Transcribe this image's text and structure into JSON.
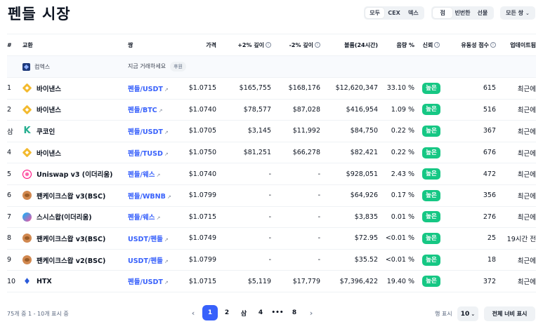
{
  "header": {
    "title": "펜들 시장",
    "filter_a": [
      "모두",
      "CEX",
      "덱스"
    ],
    "filter_b": [
      "점",
      "빈번한",
      "선물"
    ],
    "pairs_dropdown": "모든 쌍"
  },
  "table": {
    "columns": [
      "#",
      "교환",
      "쌍",
      "가격",
      "+2% 깊이",
      "-2% 깊이",
      "볼륨(24시간)",
      "음량 %",
      "신뢰",
      "유동성 점수",
      "업데이트됨"
    ],
    "sponsor": {
      "name": "컴엑스",
      "text": "지금 거래하세요",
      "badge": "후원"
    },
    "rows": [
      {
        "rank": "1",
        "exchange": "바이낸스",
        "logo": "binance-logo-icon",
        "pair": "펜들/USDT",
        "price": "$1.0715",
        "plus2": "$165,755",
        "minus2": "$168,176",
        "volume": "$12,620,347",
        "vol_pct": "33.10 %",
        "trust": "높은",
        "liq": "615",
        "updated": "최근에"
      },
      {
        "rank": "2",
        "exchange": "바이낸스",
        "logo": "binance-logo-icon",
        "pair": "펜들/BTC",
        "price": "$1.0740",
        "plus2": "$78,577",
        "minus2": "$87,028",
        "volume": "$416,954",
        "vol_pct": "1.09 %",
        "trust": "높은",
        "liq": "516",
        "updated": "최근에"
      },
      {
        "rank": "삼",
        "exchange": "쿠코인",
        "logo": "kucoin-logo-icon",
        "pair": "펜들/USDT",
        "price": "$1.0705",
        "plus2": "$3,145",
        "minus2": "$11,992",
        "volume": "$84,750",
        "vol_pct": "0.22 %",
        "trust": "높은",
        "liq": "367",
        "updated": "최근에"
      },
      {
        "rank": "4",
        "exchange": "바이낸스",
        "logo": "binance-logo-icon",
        "pair": "펜들/TUSD",
        "price": "$1.0750",
        "plus2": "$81,251",
        "minus2": "$66,278",
        "volume": "$82,421",
        "vol_pct": "0.22 %",
        "trust": "높은",
        "liq": "676",
        "updated": "최근에"
      },
      {
        "rank": "5",
        "exchange": "Uniswap v3 (이더리움)",
        "logo": "uniswap-logo-icon",
        "pair": "펜들/웨스",
        "price": "$1.0740",
        "plus2": "-",
        "minus2": "-",
        "volume": "$928,051",
        "vol_pct": "2.43 %",
        "trust": "높은",
        "liq": "472",
        "updated": "최근에"
      },
      {
        "rank": "6",
        "exchange": "팬케이크스왑 v3(BSC)",
        "logo": "pancakeswap-logo-icon",
        "pair": "펜들/WBNB",
        "price": "$1.0799",
        "plus2": "-",
        "minus2": "-",
        "volume": "$64,926",
        "vol_pct": "0.17 %",
        "trust": "높은",
        "liq": "356",
        "updated": "최근에"
      },
      {
        "rank": "7",
        "exchange": "스시스왑(이더리움)",
        "logo": "sushiswap-logo-icon",
        "pair": "펜들/웨스",
        "price": "$1.0715",
        "plus2": "-",
        "minus2": "-",
        "volume": "$3,835",
        "vol_pct": "0.01 %",
        "trust": "높은",
        "liq": "276",
        "updated": "최근에"
      },
      {
        "rank": "8",
        "exchange": "팬케이크스왑 v3(BSC)",
        "logo": "pancakeswap-logo-icon",
        "pair": "USDT/펜들",
        "price": "$1.0749",
        "plus2": "-",
        "minus2": "-",
        "volume": "$72.95",
        "vol_pct": "<0.01 %",
        "trust": "높은",
        "liq": "25",
        "updated": "19시간 전"
      },
      {
        "rank": "9",
        "exchange": "팬케이크스왑 v2(BSC)",
        "logo": "pancakeswap-logo-icon",
        "pair": "USDT/펜들",
        "price": "$1.0799",
        "plus2": "-",
        "minus2": "-",
        "volume": "$35.52",
        "vol_pct": "<0.01 %",
        "trust": "높은",
        "liq": "18",
        "updated": "최근에"
      },
      {
        "rank": "10",
        "exchange": "HTX",
        "logo": "htx-logo-icon",
        "pair": "펜들/USDT",
        "price": "$1.0715",
        "plus2": "$5,119",
        "minus2": "$17,779",
        "volume": "$7,396,422",
        "vol_pct": "19.40 %",
        "trust": "높은",
        "liq": "372",
        "updated": "최근에"
      }
    ]
  },
  "footer": {
    "summary": "75개 중 1 - 10개 표시 중",
    "pages": [
      "1",
      "2",
      "삼",
      "4",
      "•••",
      "8"
    ],
    "show_label": "행 표시",
    "rows_value": "10",
    "full_view": "전체 너비 표시"
  },
  "colors": {
    "accent": "#3861fb",
    "high": "#16c784"
  }
}
